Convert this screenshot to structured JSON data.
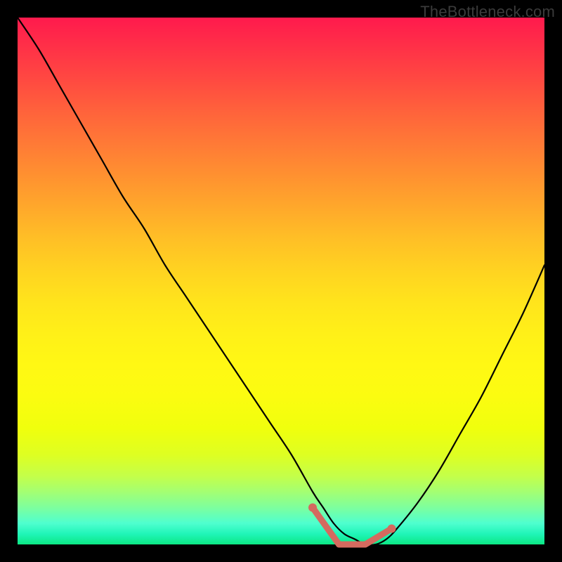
{
  "watermark": "TheBottleneck.com",
  "colors": {
    "frame": "#000000",
    "curve": "#000000",
    "marker": "#d46a5f",
    "gradient_top": "#ff1a4d",
    "gradient_bottom": "#0ce884"
  },
  "chart_data": {
    "type": "line",
    "title": "",
    "xlabel": "",
    "ylabel": "",
    "xlim": [
      0,
      100
    ],
    "ylim": [
      0,
      100
    ],
    "grid": false,
    "legend": false,
    "series": [
      {
        "name": "bottleneck-curve",
        "x": [
          0,
          4,
          8,
          12,
          16,
          20,
          24,
          28,
          32,
          36,
          40,
          44,
          48,
          52,
          56,
          58,
          60,
          62,
          64,
          66,
          68,
          70,
          72,
          76,
          80,
          84,
          88,
          92,
          96,
          100
        ],
        "y": [
          100,
          94,
          87,
          80,
          73,
          66,
          60,
          53,
          47,
          41,
          35,
          29,
          23,
          17,
          10,
          7,
          4,
          2,
          1,
          0,
          0,
          1,
          3,
          8,
          14,
          21,
          28,
          36,
          44,
          53
        ]
      }
    ],
    "highlight_range": {
      "x": [
        56,
        71
      ],
      "y": [
        7,
        0,
        0,
        3
      ]
    }
  }
}
